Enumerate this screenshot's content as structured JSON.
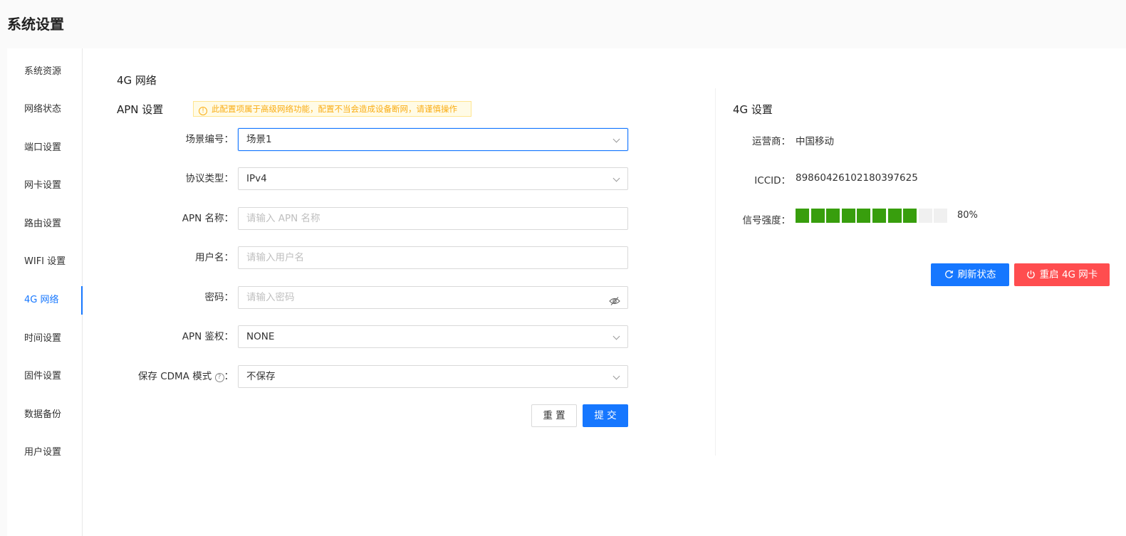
{
  "page_title": "系统设置",
  "sidebar": {
    "items": [
      {
        "label": "系统资源",
        "active": false
      },
      {
        "label": "网络状态",
        "active": false
      },
      {
        "label": "端口设置",
        "active": false
      },
      {
        "label": "网卡设置",
        "active": false
      },
      {
        "label": "路由设置",
        "active": false
      },
      {
        "label": "WIFI 设置",
        "active": false
      },
      {
        "label": "4G  网络",
        "active": true
      },
      {
        "label": "时间设置",
        "active": false
      },
      {
        "label": "固件设置",
        "active": false
      },
      {
        "label": "数据备份",
        "active": false
      },
      {
        "label": "用户设置",
        "active": false
      }
    ]
  },
  "section_title": "4G 网络",
  "apn": {
    "title": "APN 设置",
    "warning": "此配置项属于高级网络功能，配置不当会造成设备断网，请谨慎操作",
    "fields": {
      "scene": {
        "label": "场景编号：",
        "value": "场景1"
      },
      "protocol": {
        "label": "协议类型：",
        "value": "IPv4"
      },
      "apn_name": {
        "label": "APN 名称：",
        "value": "",
        "placeholder": "请输入 APN 名称"
      },
      "username": {
        "label": "用户名：",
        "value": "",
        "placeholder": "请输入用户名"
      },
      "password": {
        "label": "密码：",
        "value": "",
        "placeholder": "请输入密码"
      },
      "auth": {
        "label": "APN 鉴权：",
        "value": "NONE"
      },
      "cdma": {
        "label": "保存 CDMA 模式",
        "label_suffix": "：",
        "value": "不保存"
      }
    },
    "reset_label": "重 置",
    "submit_label": "提 交"
  },
  "g4": {
    "title": "4G 设置",
    "carrier_label": "运营商：",
    "carrier_value": "中国移动",
    "iccid_label": "ICCID：",
    "iccid_value": "89860426102180397625",
    "signal_label": "信号强度：",
    "signal_percent": 80,
    "signal_text": "80%",
    "signal_total_bars": 10,
    "signal_color": "#389e0d",
    "signal_empty_color": "#f0f0f0",
    "refresh_label": "刷新状态",
    "restart_label": "重启 4G 网卡"
  },
  "colors": {
    "primary": "#1677ff",
    "danger": "#ff4d4f",
    "warning": "#faad14"
  }
}
